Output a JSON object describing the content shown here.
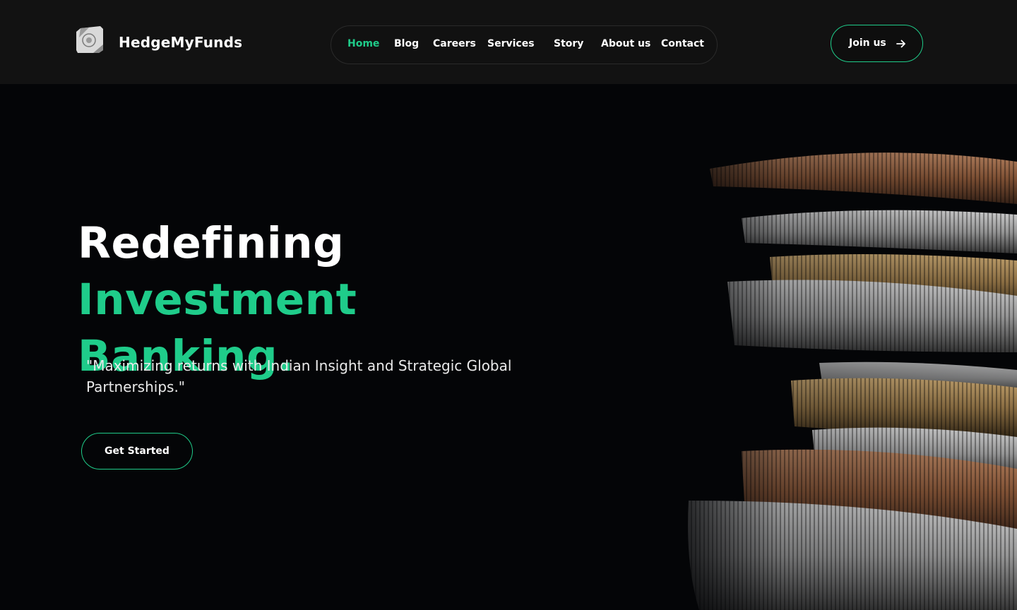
{
  "brand": {
    "name": "HedgeMyFunds",
    "logo_text": "HEDGE MY FUNDS"
  },
  "nav": {
    "items": [
      {
        "label": "Home",
        "active": true
      },
      {
        "label": "Blog",
        "active": false
      },
      {
        "label": "Careers",
        "active": false
      },
      {
        "label": "Services",
        "active": false
      },
      {
        "label": "Story",
        "active": false
      },
      {
        "label": "About us",
        "active": false
      },
      {
        "label": "Contact",
        "active": false
      }
    ]
  },
  "header": {
    "join_label": "Join us",
    "join_icon": "arrow-right-icon"
  },
  "hero": {
    "title_part1": "Redefining",
    "title_part2": "Investment",
    "title_part3": "Banking.",
    "tagline": "\"Maximizing returns with Indian Insight and Strategic Global Partnerships.\"",
    "cta_label": "Get Started",
    "image": "stacked-coins"
  },
  "colors": {
    "accent": "#1fcc8a",
    "background": "#040507",
    "header_bg": "#121212"
  }
}
